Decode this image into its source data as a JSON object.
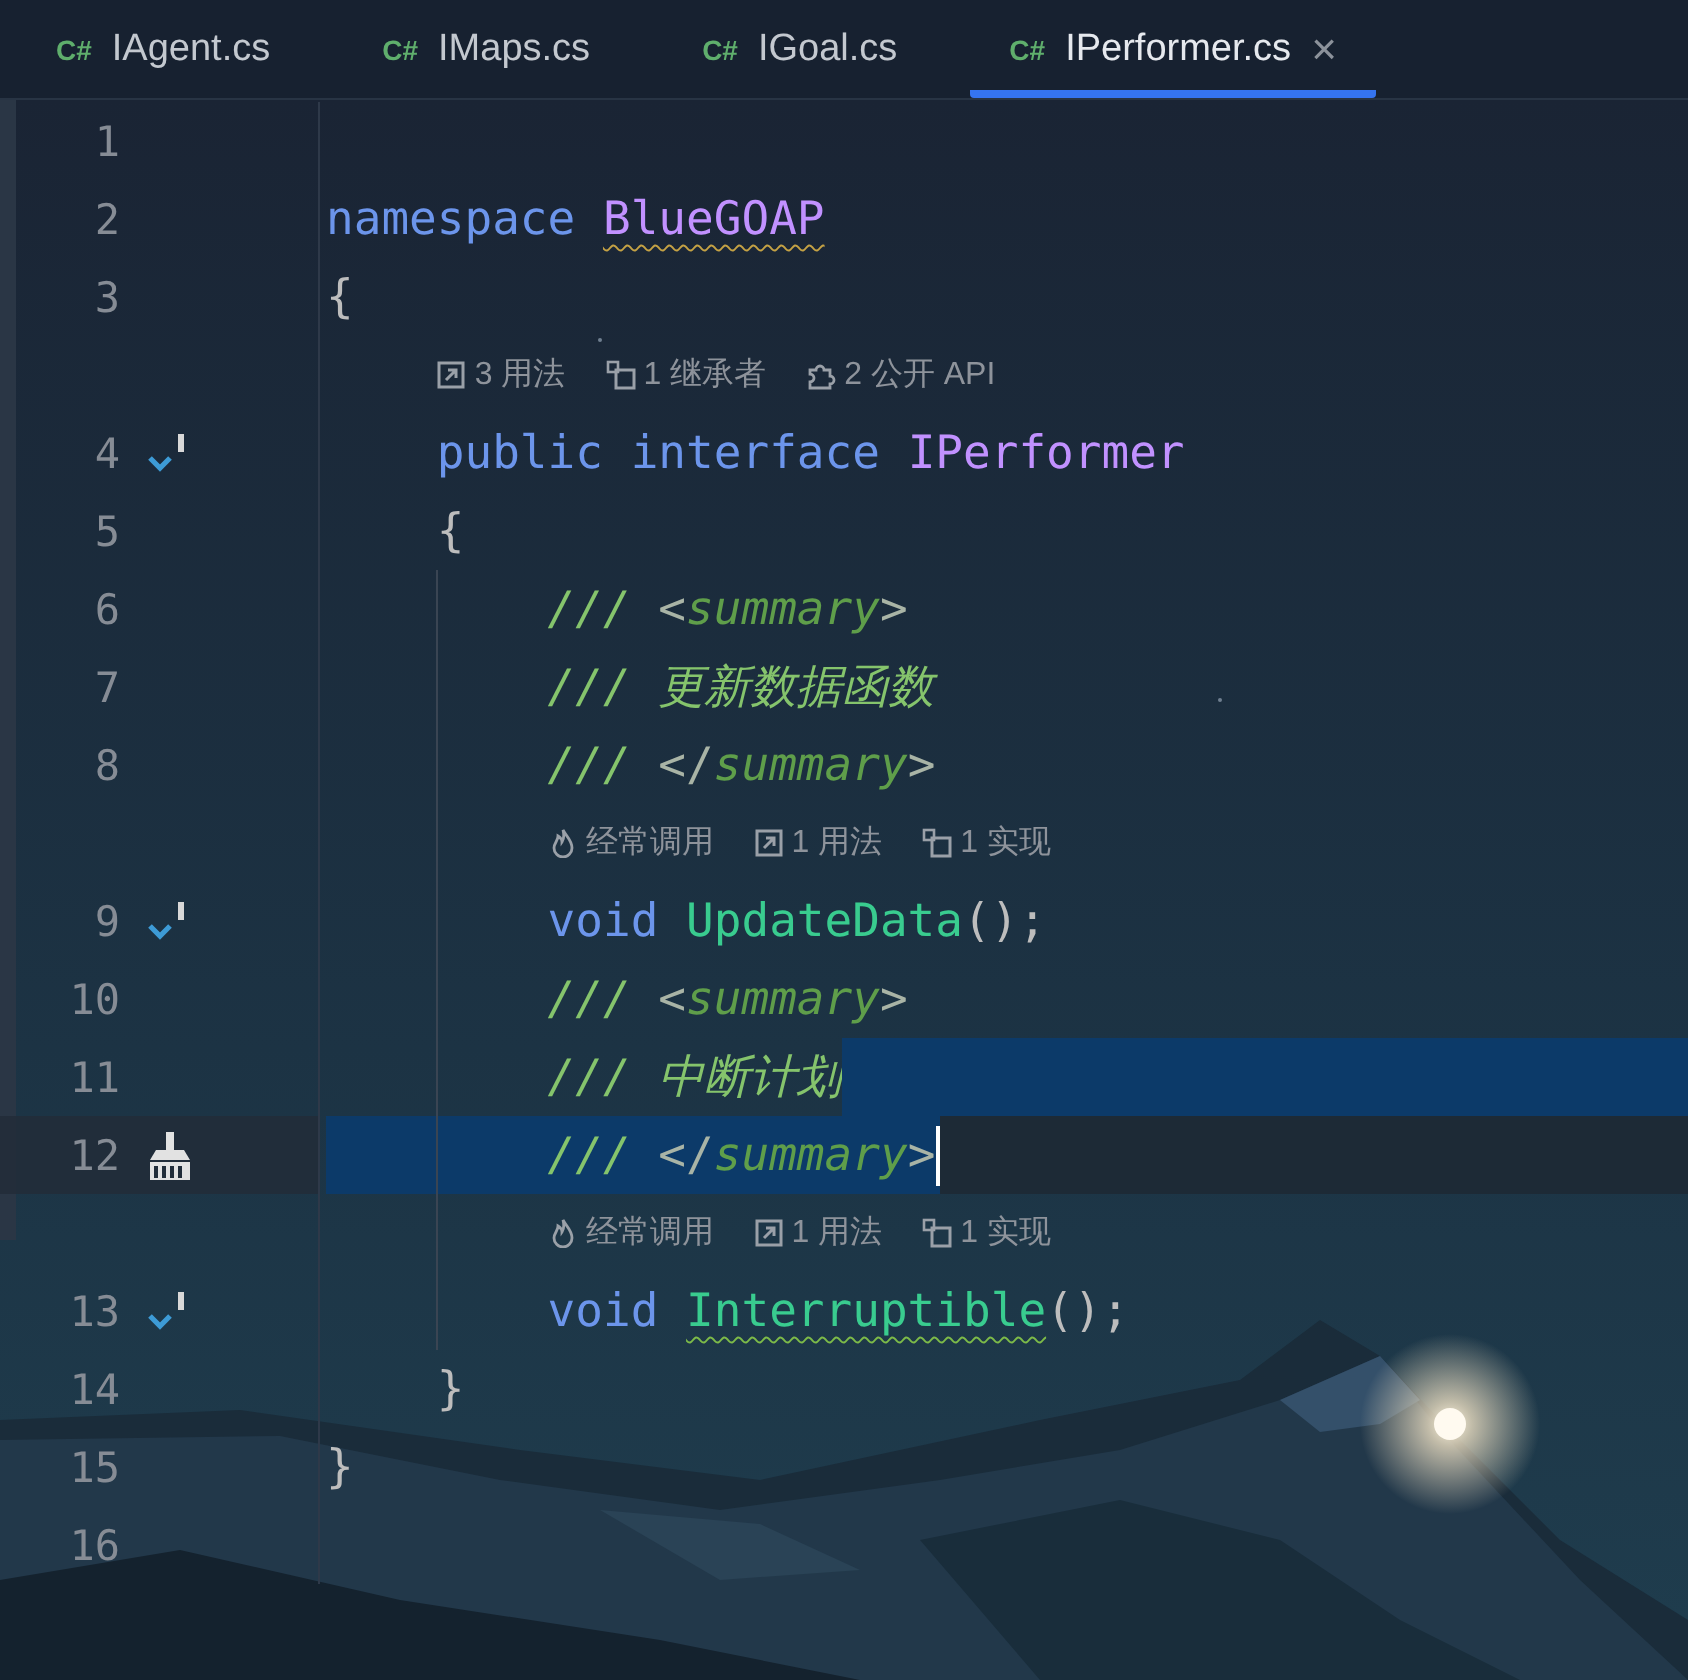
{
  "tabs": [
    {
      "lang": "C#",
      "label": "IAgent.cs",
      "selected": false
    },
    {
      "lang": "C#",
      "label": "IMaps.cs",
      "selected": false
    },
    {
      "lang": "C#",
      "label": "IGoal.cs",
      "selected": false
    },
    {
      "lang": "C#",
      "label": "IPerformer.cs",
      "selected": true,
      "close": "×"
    }
  ],
  "editor": {
    "rows": [
      {
        "kind": "code",
        "number": "1"
      },
      {
        "kind": "code",
        "number": "2",
        "tokens": [
          {
            "text": "namespace ",
            "kind": "keyword"
          },
          {
            "text": "BlueGOAP",
            "kind": "namespace",
            "squiggle": true
          }
        ]
      },
      {
        "kind": "code",
        "number": "3",
        "tokens": [
          {
            "text": "{",
            "kind": "punct"
          }
        ],
        "children": [
          {
            "kind": "hints",
            "hints": [
              {
                "kind": "usages",
                "text": "3 用法"
              },
              {
                "kind": "inheritors",
                "text": "1 继承者"
              },
              {
                "kind": "api",
                "text": "2 公开 API"
              }
            ]
          },
          {
            "kind": "code",
            "number": "4",
            "marker": {
              "kind": "implemented"
            },
            "tokens": [
              {
                "text": "public ",
                "kind": "keyword"
              },
              {
                "text": "interface ",
                "kind": "keyword"
              },
              {
                "text": "IPerformer",
                "kind": "type"
              }
            ]
          },
          {
            "kind": "code",
            "number": "5",
            "tokens": [
              {
                "text": "{",
                "kind": "punct"
              }
            ],
            "children": [
              {
                "kind": "code",
                "number": "6",
                "tokens": [
                  {
                    "text": "/// ",
                    "kind": "comment"
                  },
                  {
                    "text": "<",
                    "kind": "doc_punct"
                  },
                  {
                    "text": "summary",
                    "kind": "doc_tag"
                  },
                  {
                    "text": ">",
                    "kind": "doc_punct"
                  }
                ]
              },
              {
                "kind": "code",
                "number": "7",
                "tokens": [
                  {
                    "text": "/// ",
                    "kind": "comment"
                  },
                  {
                    "text": "更新数据函数",
                    "kind": "comment"
                  }
                ]
              },
              {
                "kind": "code",
                "number": "8",
                "tokens": [
                  {
                    "text": "/// ",
                    "kind": "comment"
                  },
                  {
                    "text": "</",
                    "kind": "doc_punct"
                  },
                  {
                    "text": "summary",
                    "kind": "doc_tag"
                  },
                  {
                    "text": ">",
                    "kind": "doc_punct"
                  }
                ]
              },
              {
                "kind": "hints",
                "hints": [
                  {
                    "kind": "frequent",
                    "text": "经常调用"
                  },
                  {
                    "kind": "usages",
                    "text": "1 用法"
                  },
                  {
                    "kind": "implementations",
                    "text": "1 实现"
                  }
                ]
              },
              {
                "kind": "code",
                "number": "9",
                "marker": {
                  "kind": "implemented"
                },
                "tokens": [
                  {
                    "text": "void ",
                    "kind": "keyword"
                  },
                  {
                    "text": "UpdateData",
                    "kind": "method"
                  },
                  {
                    "text": "();",
                    "kind": "punct"
                  }
                ]
              },
              {
                "kind": "code",
                "number": "10",
                "tokens": [
                  {
                    "text": "/// ",
                    "kind": "comment"
                  },
                  {
                    "text": "<",
                    "kind": "doc_punct"
                  },
                  {
                    "text": "summary",
                    "kind": "doc_tag"
                  },
                  {
                    "text": ">",
                    "kind": "doc_punct"
                  }
                ]
              },
              {
                "kind": "code",
                "number": "11",
                "selected": true,
                "tokens": [
                  {
                    "text": "/// ",
                    "kind": "comment"
                  },
                  {
                    "text": "中断计划",
                    "kind": "comment"
                  }
                ]
              },
              {
                "kind": "code",
                "number": "12",
                "marker": {
                  "kind": "cleanup"
                },
                "selected": true,
                "current": true,
                "caret": true,
                "tokens": [
                  {
                    "text": "/// ",
                    "kind": "comment"
                  },
                  {
                    "text": "</",
                    "kind": "doc_punct"
                  },
                  {
                    "text": "summary",
                    "kind": "doc_tag"
                  },
                  {
                    "text": ">",
                    "kind": "doc_punct"
                  }
                ]
              },
              {
                "kind": "hints",
                "hints": [
                  {
                    "kind": "frequent",
                    "text": "经常调用"
                  },
                  {
                    "kind": "usages",
                    "text": "1 用法"
                  },
                  {
                    "kind": "implementations",
                    "text": "1 实现"
                  }
                ]
              },
              {
                "kind": "code",
                "number": "13",
                "marker": {
                  "kind": "implemented"
                },
                "tokens": [
                  {
                    "text": "void ",
                    "kind": "keyword"
                  },
                  {
                    "text": "Interruptible",
                    "kind": "method",
                    "squiggle": true
                  },
                  {
                    "text": "();",
                    "kind": "punct"
                  }
                ]
              }
            ]
          },
          {
            "kind": "code",
            "number": "14",
            "tokens": [
              {
                "text": "}",
                "kind": "punct"
              }
            ]
          }
        ]
      },
      {
        "kind": "code",
        "number": "15",
        "tokens": [
          {
            "text": "}",
            "kind": "punct"
          }
        ]
      },
      {
        "kind": "code",
        "number": "16"
      }
    ]
  }
}
